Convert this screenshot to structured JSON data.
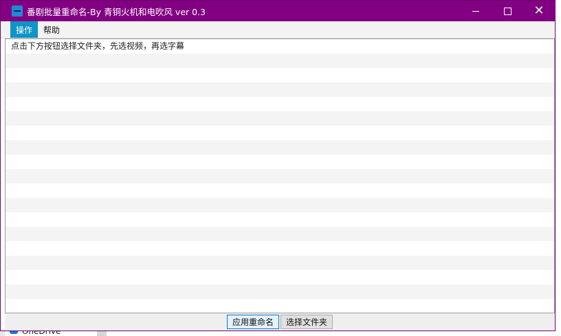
{
  "window": {
    "title": "番剧批量重命名-By 青铜火机和电吹风 ver 0.3",
    "icon": "app-icon",
    "title_color": "#820082"
  },
  "controls": {
    "minimize_icon": "minimize-icon",
    "maximize_icon": "maximize-icon",
    "close_glyph": "✕"
  },
  "menu": {
    "items": [
      {
        "label": "操作",
        "active": true
      },
      {
        "label": "帮助",
        "active": false
      }
    ]
  },
  "list": {
    "rows": [
      "点击下方按钮选择文件夹，先选视频，再选字幕",
      "",
      "",
      "",
      "",
      "",
      "",
      "",
      "",
      "",
      "",
      "",
      "",
      "",
      "",
      "",
      "",
      "",
      ""
    ]
  },
  "footer": {
    "apply_label": "应用重命名",
    "select_folder_label": "选择文件夹"
  },
  "background": {
    "onedrive_label": "OneDrive"
  }
}
